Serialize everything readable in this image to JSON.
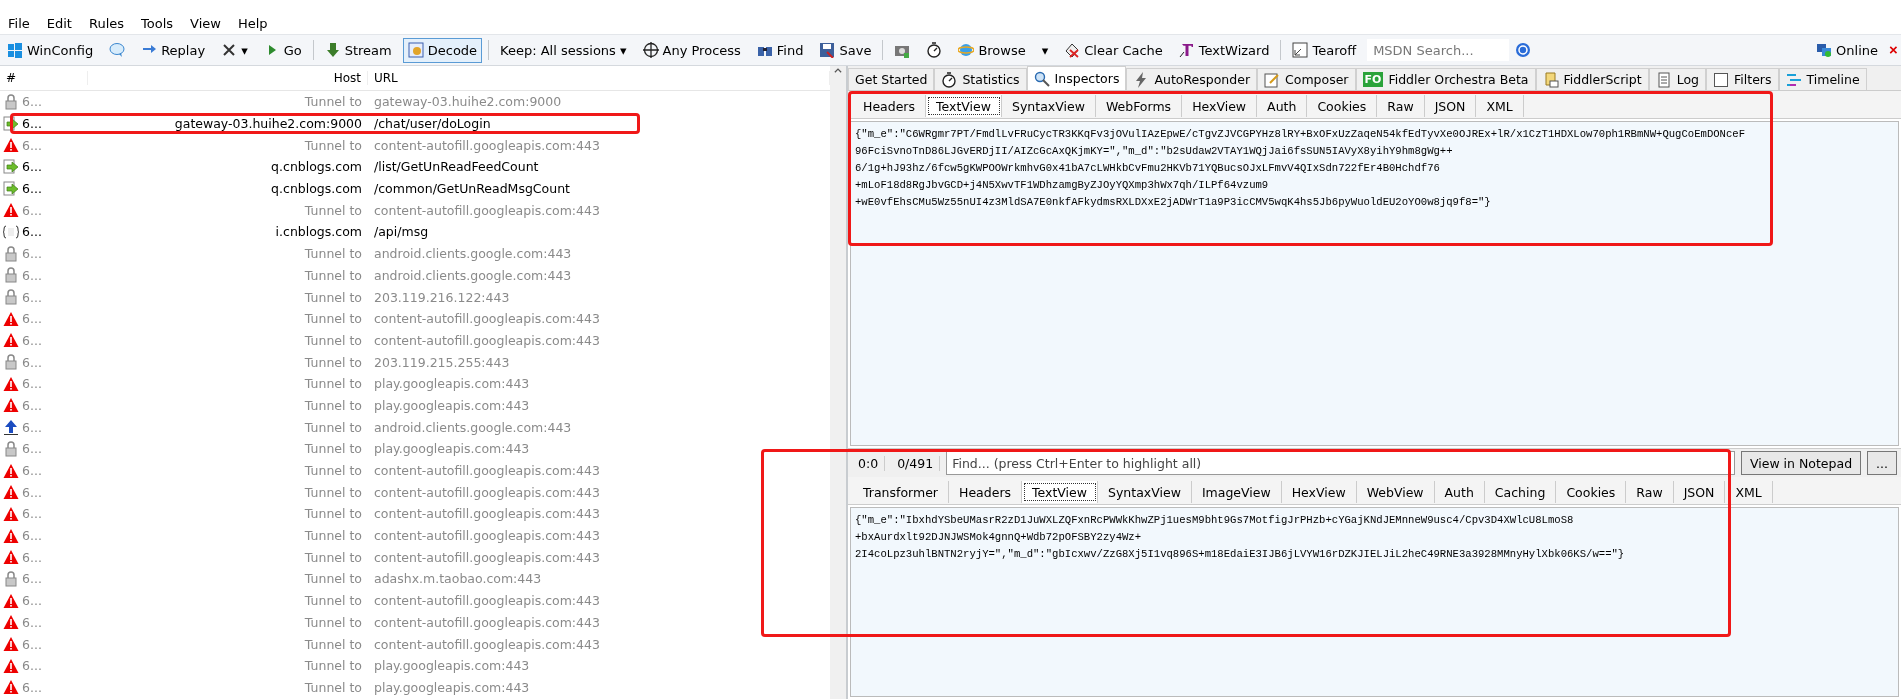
{
  "menu": [
    "File",
    "Edit",
    "Rules",
    "Tools",
    "View",
    "Help"
  ],
  "toolbar": [
    {
      "kind": "winconfig",
      "label": "WinConfig"
    },
    {
      "kind": "comment"
    },
    {
      "kind": "replay",
      "label": "Replay"
    },
    {
      "kind": "remove",
      "label": "▾"
    },
    {
      "kind": "go",
      "label": "Go"
    },
    {
      "kind": "sep"
    },
    {
      "kind": "stream",
      "label": "Stream"
    },
    {
      "kind": "decode",
      "label": "Decode",
      "pressed": true
    },
    {
      "kind": "sep"
    },
    {
      "kind": "keep",
      "label": "Keep: All sessions ▾"
    },
    {
      "kind": "process",
      "label": "Any Process"
    },
    {
      "kind": "find",
      "label": "Find"
    },
    {
      "kind": "save",
      "label": "Save"
    },
    {
      "kind": "sep"
    },
    {
      "kind": "camera"
    },
    {
      "kind": "timer"
    },
    {
      "kind": "browse",
      "label": "Browse"
    },
    {
      "kind": "dropdown",
      "label": "▾"
    },
    {
      "kind": "clearcache",
      "label": "Clear Cache"
    },
    {
      "kind": "textwizard",
      "label": "TextWizard"
    },
    {
      "kind": "sep"
    },
    {
      "kind": "tearoff",
      "label": "Tearoff"
    }
  ],
  "msdn_search": {
    "placeholder": "MSDN Search..."
  },
  "online": "Online",
  "sessions": {
    "columns": [
      "#",
      "Host",
      "URL"
    ],
    "rows": [
      {
        "kind": "lock",
        "num": "6...",
        "host": "Tunnel to",
        "url": "gateway-03.huihe2.com:9000",
        "dimmed": true,
        "marked": false
      },
      {
        "kind": "request",
        "num": "6...",
        "host": "gateway-03.huihe2.com:9000",
        "url": "/chat/user/doLogin",
        "dimmed": false,
        "marked": true
      },
      {
        "kind": "warning",
        "num": "6...",
        "host": "Tunnel to",
        "url": "content-autofill.googleapis.com:443",
        "dimmed": true,
        "marked": false
      },
      {
        "kind": "request",
        "num": "6...",
        "host": "q.cnblogs.com",
        "url": "/list/GetUnReadFeedCount",
        "dimmed": false,
        "marked": false
      },
      {
        "kind": "request",
        "num": "6...",
        "host": "q.cnblogs.com",
        "url": "/common/GetUnReadMsgCount",
        "dimmed": false,
        "marked": false
      },
      {
        "kind": "warning",
        "num": "6...",
        "host": "Tunnel to",
        "url": "content-autofill.googleapis.com:443",
        "dimmed": true,
        "marked": false
      },
      {
        "kind": "json",
        "num": "6...",
        "host": "i.cnblogs.com",
        "url": "/api/msg",
        "dimmed": false,
        "marked": false
      },
      {
        "kind": "lock",
        "num": "6...",
        "host": "Tunnel to",
        "url": "android.clients.google.com:443",
        "dimmed": true,
        "marked": false
      },
      {
        "kind": "lock",
        "num": "6...",
        "host": "Tunnel to",
        "url": "android.clients.google.com:443",
        "dimmed": true,
        "marked": false
      },
      {
        "kind": "lock",
        "num": "6...",
        "host": "Tunnel to",
        "url": "203.119.216.122:443",
        "dimmed": true,
        "marked": false
      },
      {
        "kind": "warning",
        "num": "6...",
        "host": "Tunnel to",
        "url": "content-autofill.googleapis.com:443",
        "dimmed": true,
        "marked": false
      },
      {
        "kind": "warning",
        "num": "6...",
        "host": "Tunnel to",
        "url": "content-autofill.googleapis.com:443",
        "dimmed": true,
        "marked": false
      },
      {
        "kind": "lock",
        "num": "6...",
        "host": "Tunnel to",
        "url": "203.119.215.255:443",
        "dimmed": true,
        "marked": false
      },
      {
        "kind": "warning",
        "num": "6...",
        "host": "Tunnel to",
        "url": "play.googleapis.com:443",
        "dimmed": true,
        "marked": false
      },
      {
        "kind": "warning",
        "num": "6...",
        "host": "Tunnel to",
        "url": "play.googleapis.com:443",
        "dimmed": true,
        "marked": false
      },
      {
        "kind": "upload",
        "num": "6...",
        "host": "Tunnel to",
        "url": "android.clients.google.com:443",
        "dimmed": true,
        "marked": false
      },
      {
        "kind": "lock",
        "num": "6...",
        "host": "Tunnel to",
        "url": "play.googleapis.com:443",
        "dimmed": true,
        "marked": false
      },
      {
        "kind": "warning",
        "num": "6...",
        "host": "Tunnel to",
        "url": "content-autofill.googleapis.com:443",
        "dimmed": true,
        "marked": false
      },
      {
        "kind": "warning",
        "num": "6...",
        "host": "Tunnel to",
        "url": "content-autofill.googleapis.com:443",
        "dimmed": true,
        "marked": false
      },
      {
        "kind": "warning",
        "num": "6...",
        "host": "Tunnel to",
        "url": "content-autofill.googleapis.com:443",
        "dimmed": true,
        "marked": false
      },
      {
        "kind": "warning",
        "num": "6...",
        "host": "Tunnel to",
        "url": "content-autofill.googleapis.com:443",
        "dimmed": true,
        "marked": false
      },
      {
        "kind": "warning",
        "num": "6...",
        "host": "Tunnel to",
        "url": "content-autofill.googleapis.com:443",
        "dimmed": true,
        "marked": false
      },
      {
        "kind": "lock",
        "num": "6...",
        "host": "Tunnel to",
        "url": "adashx.m.taobao.com:443",
        "dimmed": true,
        "marked": false
      },
      {
        "kind": "warning",
        "num": "6...",
        "host": "Tunnel to",
        "url": "content-autofill.googleapis.com:443",
        "dimmed": true,
        "marked": false
      },
      {
        "kind": "warning",
        "num": "6...",
        "host": "Tunnel to",
        "url": "content-autofill.googleapis.com:443",
        "dimmed": true,
        "marked": false
      },
      {
        "kind": "warning",
        "num": "6...",
        "host": "Tunnel to",
        "url": "content-autofill.googleapis.com:443",
        "dimmed": true,
        "marked": false
      },
      {
        "kind": "warning",
        "num": "6...",
        "host": "Tunnel to",
        "url": "play.googleapis.com:443",
        "dimmed": true,
        "marked": false
      },
      {
        "kind": "warning",
        "num": "6...",
        "host": "Tunnel to",
        "url": "play.googleapis.com:443",
        "dimmed": true,
        "marked": false
      }
    ]
  },
  "main_tabs": [
    {
      "kind": "start",
      "label": "Get Started",
      "selected": false
    },
    {
      "kind": "stats",
      "label": "Statistics",
      "selected": false
    },
    {
      "kind": "inspect",
      "label": "Inspectors",
      "selected": true
    },
    {
      "kind": "auto",
      "label": "AutoResponder",
      "selected": false
    },
    {
      "kind": "compose",
      "label": "Composer",
      "selected": false
    },
    {
      "kind": "orchestra",
      "label": "Fiddler Orchestra Beta",
      "badge": "FO",
      "selected": false
    },
    {
      "kind": "script",
      "label": "FiddlerScript",
      "selected": false
    },
    {
      "kind": "log",
      "label": "Log",
      "selected": false
    },
    {
      "kind": "filters",
      "label": "Filters",
      "selected": false
    },
    {
      "kind": "timeline",
      "label": "Timeline",
      "selected": false
    }
  ],
  "request": {
    "marked": true,
    "tabs": [
      {
        "label": "Headers",
        "selected": false
      },
      {
        "label": "TextView",
        "selected": true
      },
      {
        "label": "SyntaxView",
        "selected": false
      },
      {
        "label": "WebForms",
        "selected": false
      },
      {
        "label": "HexView",
        "selected": false
      },
      {
        "label": "Auth",
        "selected": false
      },
      {
        "label": "Cookies",
        "selected": false
      },
      {
        "label": "Raw",
        "selected": false
      },
      {
        "label": "JSON",
        "selected": false
      },
      {
        "label": "XML",
        "selected": false
      }
    ],
    "body": [
      "{\"m_e\":\"C6WRgmr7PT/FmdlLvFRuCycTR3KKqFv3jOVulIAzEpwE/cTgvZJVCGPYHz8lRY+BxOFxUzZaqeN54kfEdTyvXe0OJREx+lR/x1CzT1HDXLow70ph1RBmNW+QugCoEmDONceF",
      "96FciSvnoTnD86LJGvERDjII/AIZcGcAxQKjmKY=\",\"m_d\":\"b2sUdaw2VTAY1WQjJai6fsSUN5IAVyX8yihY9hm8gWg++",
      "6/1g+hJ93hz/6fcw5gKWPOOWrkmhvG0x41bA7cLWHkbCvFmu2HKVb71YQBucsOJxLFmvV4QIxSdn722fEr4B0Hchdf76",
      "+mLoF18d8RgJbvGCD+j4N5XwvTF1WDhzamgByZJOyYQXmp3hWx7qh/ILPf64vzum9",
      "+wE0vfEhsCMu5Wz55nUI4z3MldSA7E0nkfAFkydmsRXLDXxE2jADWrT1a9P3icCMV5wqK4hs5Jb6pyWuoldEU2oYO0w8jq9f8=\"}"
    ]
  },
  "find_bar": {
    "position": "0:0",
    "count": "0/491",
    "placeholder": "Find... (press Ctrl+Enter to highlight all)",
    "notepad_button": "View in Notepad",
    "more_button": "..."
  },
  "response": {
    "marked": true,
    "tabs": [
      {
        "label": "Transformer",
        "selected": false
      },
      {
        "label": "Headers",
        "selected": false
      },
      {
        "label": "TextView",
        "selected": true
      },
      {
        "label": "SyntaxView",
        "selected": false
      },
      {
        "label": "ImageView",
        "selected": false
      },
      {
        "label": "HexView",
        "selected": false
      },
      {
        "label": "WebView",
        "selected": false
      },
      {
        "label": "Auth",
        "selected": false
      },
      {
        "label": "Caching",
        "selected": false
      },
      {
        "label": "Cookies",
        "selected": false
      },
      {
        "label": "Raw",
        "selected": false
      },
      {
        "label": "JSON",
        "selected": false
      },
      {
        "label": "XML",
        "selected": false
      }
    ],
    "body": [
      "{\"m_e\":\"IbxhdYSbeUMasrR2zD1JuWXLZQFxnRcPWWkKhwZPj1uesM9bht9Gs7MotfigJrPHzb+cYGajKNdJEMnneW9usc4/Cpv3D4XWlcU8LmoS8",
      "+bxAurdxlt92DJNJWSMok4gnnQ+Wdb72pOFSBY2zy4Wz+",
      "2I4coLpz3uhlBNTN2ryjY=\",\"m_d\":\"gbIcxwv/ZzG8Xj5I1vq896S+m18EdaiE3IJB6jLVYW16rDZKJIELJiL2heC49RNE3a3928MMnyHylXbk06KS/w==\"}"
    ]
  }
}
